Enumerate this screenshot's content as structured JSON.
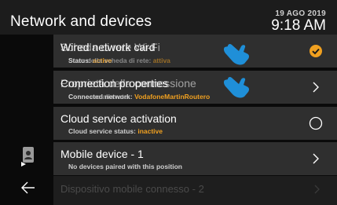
{
  "header": {
    "title": "Network and devices",
    "date": "19 AGO 2019",
    "time": "9:18 AM"
  },
  "rows": [
    {
      "label": "Wired network card",
      "label_overlay": "Scheda di rete Wi-Fi",
      "sub_prefix": "Status: ",
      "sub_overlay": "Stato della scheda di rete: ",
      "sub_value": "active",
      "sub_value_overlay": "attiva",
      "trailing": "check-icon"
    },
    {
      "label": "Connection properties",
      "label_overlay": "Proprietà della connessione",
      "sub_prefix": "Connected network: ",
      "sub_overlay": "Connesso alla rete: ",
      "sub_value": "VodafoneMartinRoutero",
      "trailing": "chevron-right-icon"
    },
    {
      "label": "Cloud service activation",
      "sub_prefix": "Cloud service status: ",
      "sub_value": "inactive",
      "trailing": "circle-icon"
    },
    {
      "label": "Mobile device - 1",
      "sub_prefix": "No devices paired with this position",
      "trailing": "chevron-right-icon"
    }
  ],
  "bottom_row": {
    "label": "Dispositivo mobile connesso - 2"
  },
  "colors": {
    "accent": "#f0a020",
    "hand": "#1f8fd8",
    "row_bg": "#2f2f2f"
  }
}
